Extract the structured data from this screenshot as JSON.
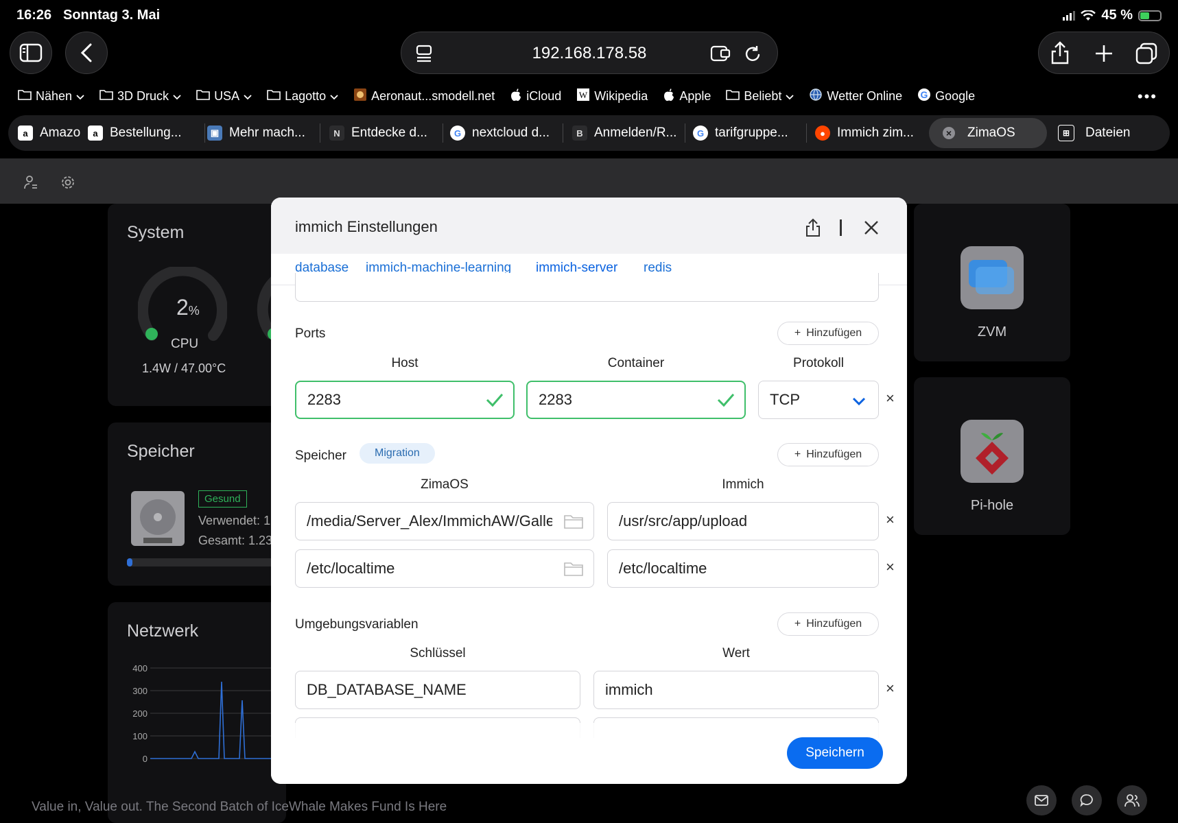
{
  "status_bar": {
    "time": "16:26",
    "date": "Sonntag 3. Mai",
    "battery": "45 %"
  },
  "browser": {
    "url": "192.168.178.58",
    "bookmarks": [
      {
        "label": "Nähen",
        "icon": "folder-icon",
        "chevron": true
      },
      {
        "label": "3D Druck",
        "icon": "folder-icon",
        "chevron": true
      },
      {
        "label": "USA",
        "icon": "folder-icon",
        "chevron": true
      },
      {
        "label": "Lagotto",
        "icon": "folder-icon",
        "chevron": true
      },
      {
        "label": "Aeronaut...smodell.net",
        "icon": "site-favicon",
        "chevron": false
      },
      {
        "label": "iCloud",
        "icon": "apple-icon",
        "chevron": false
      },
      {
        "label": "Wikipedia",
        "icon": "wikipedia-icon",
        "chevron": false
      },
      {
        "label": "Apple",
        "icon": "apple-icon",
        "chevron": false
      },
      {
        "label": "Beliebt",
        "icon": "folder-icon",
        "chevron": true
      },
      {
        "label": "Wetter Online",
        "icon": "globe-icon",
        "chevron": false
      },
      {
        "label": "Google",
        "icon": "google-icon",
        "chevron": false
      }
    ],
    "tabs": [
      {
        "label": "Amazo",
        "fav": "a"
      },
      {
        "label": "Bestellung...",
        "fav": "a"
      },
      {
        "label": "Mehr mach...",
        "fav": "▣"
      },
      {
        "label": "Entdecke d...",
        "fav": "N"
      },
      {
        "label": "nextcloud d...",
        "fav": "G"
      },
      {
        "label": "Anmelden/R...",
        "fav": "B"
      },
      {
        "label": "tarifgruppe...",
        "fav": "G"
      },
      {
        "label": "Immich zim...",
        "fav": "●"
      },
      {
        "label": "ZimaOS",
        "fav": "×"
      },
      {
        "label": "Dateien",
        "fav": "⊞"
      }
    ]
  },
  "dashboard": {
    "system_title": "System",
    "cpu_value": "2",
    "cpu_unit": "%",
    "cpu_label": "CPU",
    "cpu_info": "1.4W / 47.00°C",
    "storage_title": "Speicher",
    "storage_status": "Gesund",
    "storage_used": "Verwendet: 1",
    "storage_total": "Gesamt: 1.23",
    "network_title": "Netzwerk",
    "network_ticks": [
      "400",
      "300",
      "200",
      "100",
      "0"
    ],
    "apps": [
      {
        "name": "ZVM"
      },
      {
        "name": "Pi-hole"
      }
    ],
    "footer_text": "Value in, Value out. The Second Batch of IceWhale Makes Fund Is Here"
  },
  "modal": {
    "title": "immich Einstellungen",
    "tabs": [
      "database",
      "immich-machine-learning",
      "immich-server",
      "redis"
    ],
    "selected_tab": "immich-server",
    "ports": {
      "label": "Ports",
      "add_label": "Hinzufügen",
      "col_host": "Host",
      "col_container": "Container",
      "col_protocol": "Protokoll",
      "host": "2283",
      "container": "2283",
      "protocol": "TCP"
    },
    "storage": {
      "label": "Speicher",
      "badge": "Migration",
      "add_label": "Hinzufügen",
      "col_zimaos": "ZimaOS",
      "col_immich": "Immich",
      "rows": [
        {
          "host": "/media/Server_Alex/ImmichAW/Galle",
          "container": "/usr/src/app/upload"
        },
        {
          "host": "/etc/localtime",
          "container": "/etc/localtime"
        }
      ]
    },
    "env": {
      "label": "Umgebungsvariablen",
      "add_label": "Hinzufügen",
      "col_key": "Schlüssel",
      "col_value": "Wert",
      "key": "DB_DATABASE_NAME",
      "value": "immich"
    },
    "save_label": "Speichern"
  }
}
